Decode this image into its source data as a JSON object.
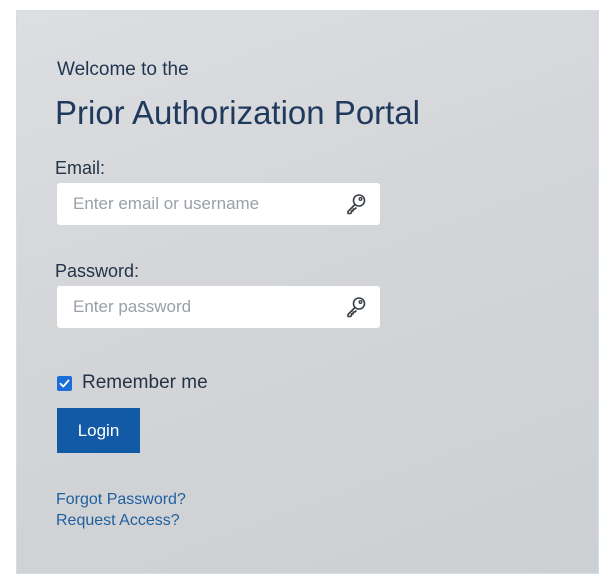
{
  "header": {
    "welcome": "Welcome to the",
    "title": "Prior Authorization Portal"
  },
  "email": {
    "label": "Email:",
    "placeholder": "Enter email or username",
    "icon": "key-icon"
  },
  "password": {
    "label": "Password:",
    "placeholder": "Enter password",
    "icon": "key-icon"
  },
  "remember": {
    "label": "Remember me",
    "checked": true
  },
  "login": {
    "label": "Login"
  },
  "links": {
    "forgot": "Forgot Password?",
    "request": "Request Access?"
  },
  "colors": {
    "primary_button": "#135aa6",
    "link": "#1f5f9e",
    "checkbox": "#1a6ed8",
    "title": "#1f3a5c"
  }
}
